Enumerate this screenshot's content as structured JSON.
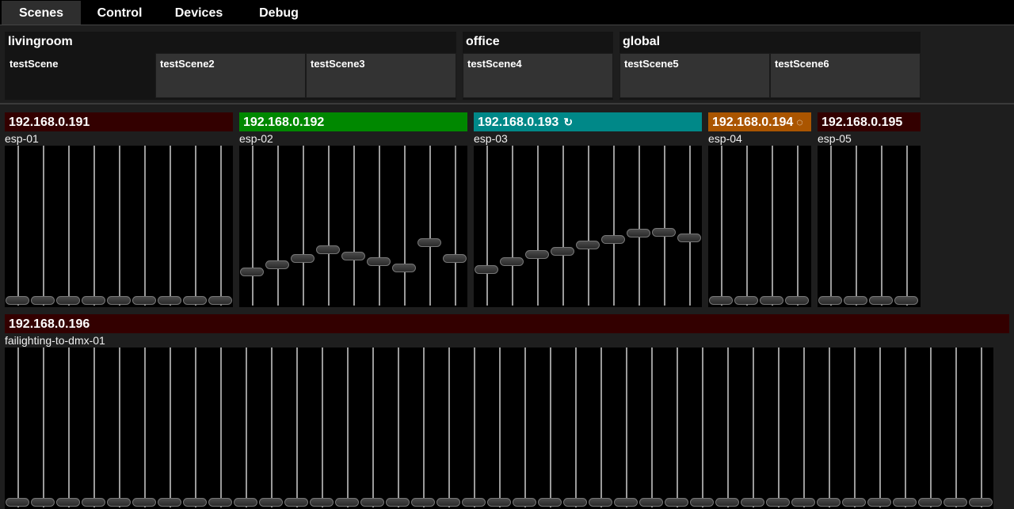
{
  "tabs": [
    {
      "label": "Scenes",
      "active": true
    },
    {
      "label": "Control",
      "active": false
    },
    {
      "label": "Devices",
      "active": false
    },
    {
      "label": "Debug",
      "active": false
    }
  ],
  "scene_groups": [
    {
      "title": "livingroom",
      "scenes": [
        {
          "label": "testScene",
          "active": true
        },
        {
          "label": "testScene2",
          "active": false
        },
        {
          "label": "testScene3",
          "active": false
        }
      ]
    },
    {
      "title": "office",
      "scenes": [
        {
          "label": "testScene4",
          "active": false
        }
      ]
    },
    {
      "title": "global",
      "scenes": [
        {
          "label": "testScene5",
          "active": false
        },
        {
          "label": "testScene6",
          "active": false
        }
      ]
    }
  ],
  "devices": [
    {
      "ip": "192.168.0.191",
      "name": "esp-01",
      "status_color": "#330000",
      "icon": "",
      "channel_values": [
        0,
        0,
        0,
        0,
        0,
        0,
        0,
        0,
        0
      ]
    },
    {
      "ip": "192.168.0.192",
      "name": "esp-02",
      "status_color": "#008800",
      "icon": "",
      "channel_values": [
        0.19,
        0.24,
        0.28,
        0.34,
        0.3,
        0.26,
        0.22,
        0.39,
        0.28
      ]
    },
    {
      "ip": "192.168.0.193",
      "name": "esp-03",
      "status_color": "#008888",
      "icon": "sync-icon",
      "channel_values": [
        0.21,
        0.26,
        0.31,
        0.33,
        0.37,
        0.41,
        0.45,
        0.46,
        0.42
      ]
    },
    {
      "ip": "192.168.0.194",
      "name": "esp-04",
      "status_color": "#aa5500",
      "icon": "loading-icon",
      "channel_values": [
        0,
        0,
        0,
        0
      ]
    },
    {
      "ip": "192.168.0.195",
      "name": "esp-05",
      "status_color": "#330000",
      "icon": "",
      "channel_values": [
        0,
        0,
        0,
        0
      ]
    },
    {
      "ip": "192.168.0.196",
      "name": "failighting-to-dmx-01",
      "status_color": "#330000",
      "icon": "",
      "channel_values": [
        0,
        0,
        0,
        0,
        0,
        0,
        0,
        0,
        0,
        0,
        0,
        0,
        0,
        0,
        0,
        0,
        0,
        0,
        0,
        0,
        0,
        0,
        0,
        0,
        0,
        0,
        0,
        0,
        0,
        0,
        0,
        0,
        0,
        0,
        0,
        0,
        0,
        0,
        0
      ]
    }
  ]
}
